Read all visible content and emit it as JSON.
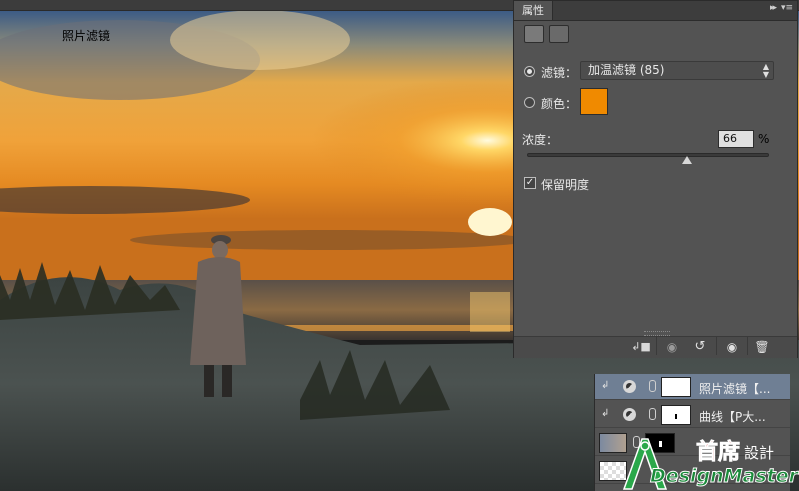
{
  "properties_panel": {
    "tab_label": "属性",
    "collapse_glyph": "▸▸",
    "menu_glyph": "▾≡",
    "header_title": "照片滤镜",
    "filter_label": "滤镜：",
    "filter_value": "加温滤镜 (85)",
    "color_label": "颜色：",
    "color_value": "#f08a00",
    "density_label": "浓度：",
    "density_value": "66",
    "density_unit": "%",
    "density_fraction": 0.66,
    "preserve_luminosity_label": "保留明度",
    "preserve_luminosity_checked": true,
    "footer_icons": [
      "clip-to-layer-icon",
      "view-previous-state-icon",
      "reset-icon",
      "visibility-eye-icon",
      "trash-icon"
    ]
  },
  "layers_panel": {
    "layers": [
      {
        "name": "照片滤镜【...",
        "selected": true,
        "kind": "photo-filter-adjustment"
      },
      {
        "name": "曲线【P大...",
        "selected": false,
        "kind": "curves-adjustment"
      },
      {
        "name": "",
        "selected": false,
        "kind": "image-with-mask"
      },
      {
        "name": "",
        "selected": false,
        "kind": "transparent-layer"
      }
    ]
  },
  "watermark": {
    "brand_cn": "首席",
    "brand_cn_small": "設計",
    "brand_en": "DesignMaster"
  }
}
